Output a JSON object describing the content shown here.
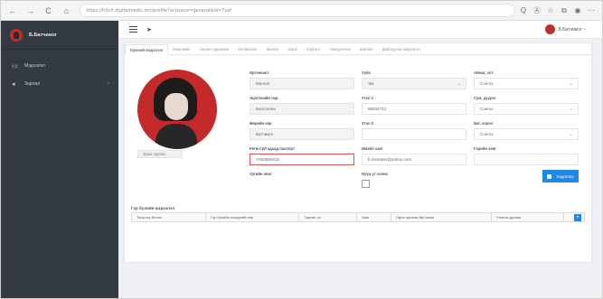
{
  "browser": {
    "url": "https://hitch.digitalmedic.mn/profile?activeno=general&id=7xaf"
  },
  "sidebar": {
    "user_name": "Б.Батчимэг",
    "items": [
      {
        "label": "Мэдээлэл",
        "icon": "monitor-icon"
      },
      {
        "label": "Зарлал",
        "icon": "megaphone-icon"
      }
    ]
  },
  "topbar": {
    "user_name": "Б.Батчимэг ~"
  },
  "tabs": [
    {
      "label": "Ерөнхий мэдээлэл",
      "active": true
    },
    {
      "label": "Мэргэжил"
    },
    {
      "label": "Ажлын туршлага"
    },
    {
      "label": "Боловсрол"
    },
    {
      "label": "Лиценз"
    },
    {
      "label": "Зэрэг"
    },
    {
      "label": "Сургалт"
    },
    {
      "label": "Гишүүнчлэл"
    },
    {
      "label": "Шагнал"
    },
    {
      "label": "Дийлгүүлэх мэдээлэл"
    }
  ],
  "photo": {
    "caption": "Зураг хуулах"
  },
  "form": {
    "ovog_label": "Ургийн овог",
    "surname_label": "Ургийн овог",
    "ovog_value": "Монгол",
    "father_label": "Эцэг/эхийн нэр",
    "father_value": "Балсгалан",
    "name_label": "Өөрийн нэр",
    "name_value": "Батчимэг",
    "register_label": "Регистр/Гадаад паспорт",
    "register_value": "УХ93080415",
    "clan_label": "Ургийн овог",
    "gender_label": "Хүйс",
    "gender_value": "Эм",
    "phone1_label": "Утас-1",
    "phone1_value": "88034722",
    "phone2_label": "Утас-2",
    "phone2_value": "",
    "email_label": "Имэйл хаяг",
    "email_value": "b.mimasss@yahoo.com",
    "password_label": "Нууц үг солих",
    "aimag_label": "Аймаг, хот",
    "aimag_value": "Сонгох",
    "sum_label": "Сум, дүүрэг",
    "sum_value": "Сонгох",
    "bag_label": "Баг, хороо",
    "bag_value": "Сонгох",
    "address_label": "Гэрийн хаяг",
    "address_value": "",
    "save_label": "Хадгалах"
  },
  "family": {
    "title": "Гэр бүлийн мэдээлэл",
    "columns": [
      "Таны юу болох",
      "Гэр бүлийн гишүүний нэр",
      "Төрсөн он",
      "Хаяг",
      "Одоо эрхэлж буй ажил",
      "Утасны дугаар"
    ]
  }
}
